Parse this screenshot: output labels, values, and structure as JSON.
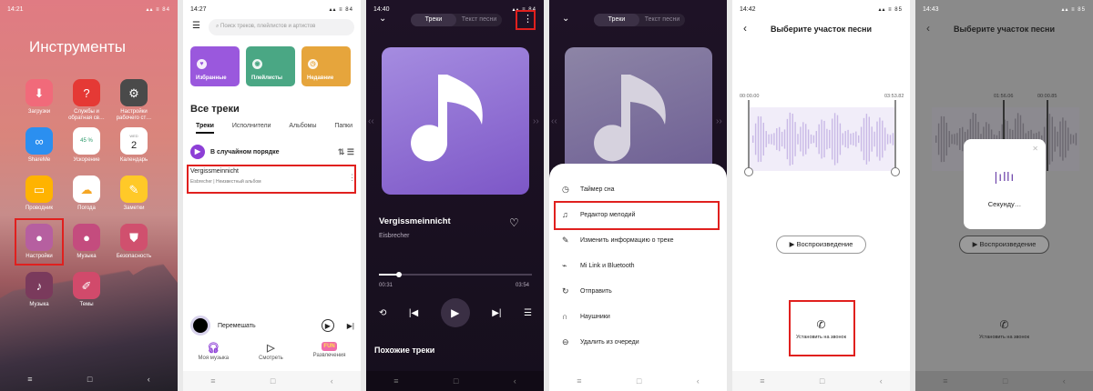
{
  "p1": {
    "time": "14:21",
    "status": "▴▴ ≡ 84",
    "title": "Инструменты",
    "apps": [
      "Загрузки",
      "Службы и обратная св…",
      "Настройки рабочего ст…",
      "ShareMe",
      "Ускорение",
      "Календарь",
      "Проводник",
      "Погода",
      "Заметки",
      "Настройки",
      "Музыка",
      "Безопасность",
      "Музыка",
      "Темы"
    ],
    "cal_day": "WED",
    "cal_num": "2",
    "boost": "45 %"
  },
  "p2": {
    "time": "14:27",
    "status": "▴▴ ≡ 84",
    "search_placeholder": "Поиск треков, плейлистов и артистов",
    "cards": [
      "Избранные",
      "Плейлисты",
      "Недавние"
    ],
    "section": "Все треки",
    "tabs": [
      "Треки",
      "Исполнители",
      "Альбомы",
      "Папки"
    ],
    "shuffle": "В случайном порядке",
    "track_title": "Vergissmeinnicht",
    "track_sub": "Eisbrecher | Неизвестный альбом",
    "mini_label": "Перемешать",
    "bottom": [
      "Моя музыка",
      "Смотреть",
      "Развлечения"
    ],
    "fun": "FUN"
  },
  "p3": {
    "time": "14:40",
    "status": "▴▴ ≡ 84",
    "tab_tracks": "Треки",
    "tab_lyrics": "Текст песни",
    "song": "Vergissmeinnicht",
    "artist": "Eisbrecher",
    "pos": "00:31",
    "dur": "03:54",
    "progress": 0.13,
    "similar": "Похожие треки"
  },
  "p4": {
    "tab_tracks": "Треки",
    "tab_lyrics": "Текст песни",
    "menu": [
      "Таймер сна",
      "Редактор мелодий",
      "Изменить информацию о треке",
      "Mi Link и Bluetooth",
      "Отправить",
      "Наушники",
      "Удалить из очереди"
    ]
  },
  "p5": {
    "time": "14:42",
    "status": "▴▴ ≡ 85",
    "header": "Выберите участок песни",
    "start": "00:00.00",
    "end": "03:53.82",
    "preview": "▶ Воспроизведение",
    "ringtone": "Установить на звонок"
  },
  "p6": {
    "time": "14:43",
    "status": "▴▴ ≡ 85",
    "header": "Выберите участок песни",
    "start": "01:56.06",
    "end": "00:00.85",
    "preview": "▶ Воспроизведение",
    "ringtone": "Установить на звонок",
    "dialog": "Секунду…"
  }
}
